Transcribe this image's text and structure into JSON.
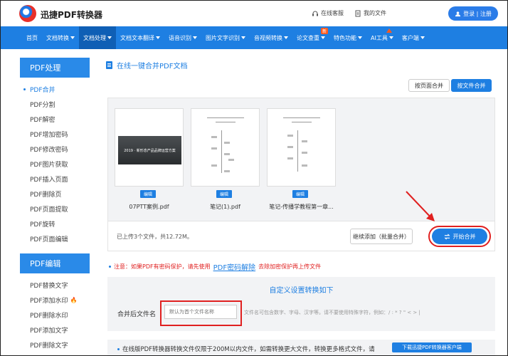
{
  "header": {
    "brand": "迅捷PDF转换器",
    "service_link": "在线客服",
    "files_link": "我的文件",
    "login_label": "登录 | 注册"
  },
  "nav": {
    "items": [
      {
        "label": "首页",
        "caret": false
      },
      {
        "label": "文档转换",
        "caret": true
      },
      {
        "label": "文档处理",
        "caret": true
      },
      {
        "label": "文档文本翻译",
        "caret": true
      },
      {
        "label": "语音识别",
        "caret": true
      },
      {
        "label": "图片文字识别",
        "caret": true
      },
      {
        "label": "音视频转换",
        "caret": true
      },
      {
        "label": "论文查重",
        "caret": true
      },
      {
        "label": "特色功能",
        "caret": true
      },
      {
        "label": "AI工具",
        "caret": true
      },
      {
        "label": "客户端",
        "caret": true
      }
    ],
    "new_badge": "新"
  },
  "sidebar": {
    "pdf_process_title": "PDF处理",
    "pdf_process_items": [
      "PDF合并",
      "PDF分割",
      "PDF解密",
      "PDF增加密码",
      "PDF修改密码",
      "PDF图片获取",
      "PDF插入页面",
      "PDF删除页",
      "PDF页面提取",
      "PDF旋转",
      "PDF页面编辑"
    ],
    "pdf_edit_title": "PDF编辑",
    "pdf_edit_items": [
      "PDF替换文字",
      "PDF添加水印",
      "PDF删除水印",
      "PDF添加文字",
      "PDF删除文字"
    ]
  },
  "main": {
    "title": "在线一键合并PDF文档",
    "tab_by_page": "按页面合并",
    "tab_by_file": "按文件合并",
    "files": [
      {
        "name": "07PTT案例.pdf",
        "thumb_text": "2019 · 新形态产品品牌运营方案"
      },
      {
        "name": "笔记(1).pdf"
      },
      {
        "name": "笔记-传播学教程第一章..."
      }
    ],
    "edit_label": "编辑",
    "status": "已上传3个文件，共12.72M。",
    "add_label": "继续添加（批量合并）",
    "merge_label": "开始合并",
    "notice_prefix": "注意：如果PDF有密码保护，请先使用",
    "notice_link": "PDF密码解除",
    "notice_suffix": "去除加密保护再上传文件",
    "settings_title": "自定义设置转换如下",
    "out_name_label": "合并后文件名",
    "out_name_placeholder": "默认为首个文件名称",
    "out_name_hint": "文件名可包含数字、字母、汉字等。请不要使用特殊字符，例如：/ : * ? \" < > |",
    "footer_text": "在线版PDF转换器转换文件仅限于200M以内文件，如需转换更大文件，转换更多格式文件，请",
    "download_label": "下载迅捷PDF转换器客户端"
  },
  "colors": {
    "accent": "#1e7fe2",
    "highlight": "#e02020"
  }
}
